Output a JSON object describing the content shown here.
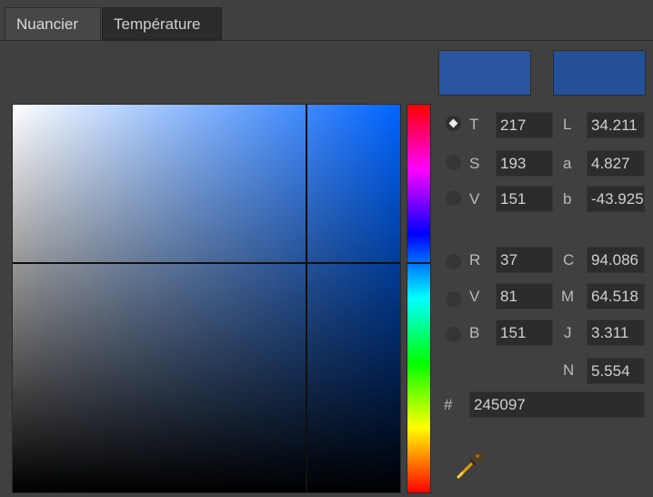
{
  "tabs": [
    {
      "label": "Nuancier",
      "active": true
    },
    {
      "label": "Température",
      "active": false
    }
  ],
  "swatches": {
    "old_color": "#2a55a0",
    "new_color": "#245097"
  },
  "hue_gradient_note": "",
  "fields": {
    "T": {
      "label": "T",
      "value": "217",
      "selected": true
    },
    "S": {
      "label": "S",
      "value": "193"
    },
    "V": {
      "label": "V",
      "value": "151"
    },
    "R": {
      "label": "R",
      "value": "37"
    },
    "G": {
      "label": "V",
      "value": "81"
    },
    "B": {
      "label": "B",
      "value": "151"
    },
    "L": {
      "label": "L",
      "value": "34.211"
    },
    "a": {
      "label": "a",
      "value": "4.827"
    },
    "b": {
      "label": "b",
      "value": "-43.925"
    },
    "C": {
      "label": "C",
      "value": "94.086"
    },
    "M": {
      "label": "M",
      "value": "64.518"
    },
    "J": {
      "label": "J",
      "value": "3.311"
    },
    "N": {
      "label": "N",
      "value": "5.554"
    }
  },
  "hex": {
    "label": "#",
    "value": "245097"
  },
  "icons": {
    "eyedropper": "eyedropper-icon"
  }
}
